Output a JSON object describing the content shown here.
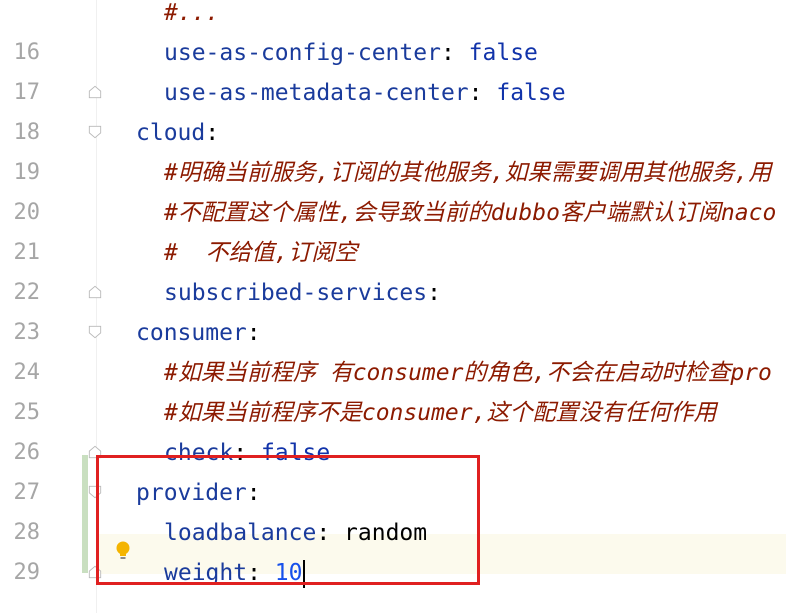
{
  "editor": {
    "lines": [
      {
        "num": "",
        "indent": 1,
        "parts": [
          {
            "t": "#",
            "c": "comment"
          },
          {
            "t": "...",
            "c": "comment"
          }
        ]
      },
      {
        "num": "16",
        "indent": 1,
        "parts": [
          {
            "t": "use-as-config-center",
            "c": "key"
          },
          {
            "t": ": ",
            "c": ""
          },
          {
            "t": "false",
            "c": "kw"
          }
        ]
      },
      {
        "num": "17",
        "indent": 1,
        "parts": [
          {
            "t": "use-as-metadata-center",
            "c": "key"
          },
          {
            "t": ": ",
            "c": ""
          },
          {
            "t": "false",
            "c": "kw"
          }
        ]
      },
      {
        "num": "18",
        "indent": 0,
        "parts": [
          {
            "t": "cloud",
            "c": "key"
          },
          {
            "t": ":",
            "c": ""
          }
        ]
      },
      {
        "num": "19",
        "indent": 1,
        "parts": [
          {
            "t": "#明确当前服务,订阅的其他服务,如果需要调用其他服务,用",
            "c": "comment"
          }
        ]
      },
      {
        "num": "20",
        "indent": 1,
        "parts": [
          {
            "t": "#不配置这个属性,会导致当前的dubbo客户端默认订阅naco",
            "c": "comment"
          }
        ]
      },
      {
        "num": "21",
        "indent": 1,
        "parts": [
          {
            "t": "#  不给值,订阅空",
            "c": "comment"
          }
        ]
      },
      {
        "num": "22",
        "indent": 1,
        "parts": [
          {
            "t": "subscribed-services",
            "c": "key"
          },
          {
            "t": ":",
            "c": ""
          }
        ]
      },
      {
        "num": "23",
        "indent": 0,
        "parts": [
          {
            "t": "consumer",
            "c": "key"
          },
          {
            "t": ":",
            "c": ""
          }
        ]
      },
      {
        "num": "24",
        "indent": 1,
        "parts": [
          {
            "t": "#如果当前程序 有consumer的角色,不会在启动时检查pro",
            "c": "comment"
          }
        ]
      },
      {
        "num": "25",
        "indent": 1,
        "parts": [
          {
            "t": "#如果当前程序不是consumer,这个配置没有任何作用",
            "c": "comment"
          }
        ]
      },
      {
        "num": "26",
        "indent": 1,
        "parts": [
          {
            "t": "check",
            "c": "key"
          },
          {
            "t": ": ",
            "c": ""
          },
          {
            "t": "false",
            "c": "kw"
          }
        ]
      },
      {
        "num": "27",
        "indent": 0,
        "parts": [
          {
            "t": "provider",
            "c": "key"
          },
          {
            "t": ":",
            "c": ""
          }
        ]
      },
      {
        "num": "28",
        "indent": 1,
        "parts": [
          {
            "t": "loadbalance",
            "c": "key"
          },
          {
            "t": ": ",
            "c": ""
          },
          {
            "t": "random",
            "c": ""
          }
        ]
      },
      {
        "num": "29",
        "indent": 1,
        "parts": [
          {
            "t": "weight",
            "c": "key"
          },
          {
            "t": ": ",
            "c": ""
          },
          {
            "t": "10",
            "c": "num"
          }
        ]
      }
    ]
  },
  "icons": {
    "bulb": "lightbulb-icon",
    "fold": "fold-marker-icon"
  }
}
